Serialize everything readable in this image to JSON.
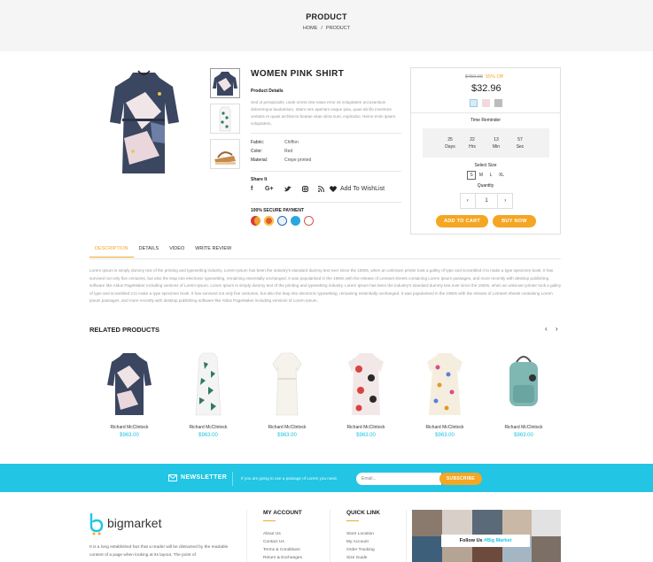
{
  "hero": {
    "title": "PRODUCT",
    "breadcrumb": [
      "HOME",
      "/",
      "PRODUCT"
    ]
  },
  "product": {
    "title": "WOMEN PINK SHIRT",
    "details_label": "Product Details",
    "description": "Sed ut perspiciatis, unde omnis iste natus error sit voluptatem accusantium doloremque laudantium, totam rem aperiam eaque ipsa, quae ab illo inventore veritatis et quasi architecto beatae vitae dicta sunt, explicabo. Nemo enim ipsam voluptatem,",
    "attributes": [
      {
        "label": "Fabric:",
        "value": "Chiffon"
      },
      {
        "label": "Color:",
        "value": "Red"
      },
      {
        "label": "Material:",
        "value": "Crepe printed"
      }
    ],
    "share_label": "Share It",
    "wishlist": "Add To WishList",
    "payment_label": "100% SECURE PAYMENT"
  },
  "buybox": {
    "old_price": "$450.00",
    "discount": "55% Off",
    "price": "$32.96",
    "swatch_colors": [
      "#d6ecf8",
      "#f2d9de",
      "#bcbcbc"
    ],
    "time_reminder": "Time Reminder",
    "timer": [
      {
        "value": "25",
        "unit": "Days"
      },
      {
        "value": "22",
        "unit": "Hrs"
      },
      {
        "value": "13",
        "unit": "Min"
      },
      {
        "value": "57",
        "unit": "Sec"
      }
    ],
    "select_size": "Select Size",
    "sizes": [
      "S",
      "M",
      "L",
      "XL"
    ],
    "quantity_label": "Quantity",
    "quantity_minus": "‹",
    "quantity": "1",
    "quantity_plus": "›",
    "add_to_cart": "ADD TO CART",
    "buy_now": "BUY NOW"
  },
  "tabs": [
    "DESCRIPTION",
    "DETAILS",
    "VIDEO",
    "WRITE REVIEW"
  ],
  "long_description": "Lorem Ipsum is simply dummy text of the printing and typesetting industry. Lorem Ipsum has been the industry's standard dummy text ever since the 1500s, when an unknown printer took a galley of type and scrambled it to make a type specimen book. It has survived not only five centuries, but also the leap into electronic typesetting, remaining essentially unchanged. It was popularised in the 1960s with the release of Letraset sheets containing Lorem Ipsum passages, and more recently with desktop publishing software like Aldus PageMaker including versions of Lorem Ipsum. Lorem Ipsum is simply dummy text of the printing and typesetting industry. Lorem Ipsum has been the industry's standard dummy text ever since the 1500s, when an unknown printer took a galley of type and scrambled it to make a type specimen book. It has survived not only five centuries, but also the leap into electronic typesetting, remaining essentially unchanged. It was popularised in the 1960s with the release of Letraset sheets containing Lorem Ipsum passages, and more recently with desktop publishing software like Aldus PageMaker including versions of Lorem Ipsum.",
  "related": {
    "title": "RELATED PRODUCTS",
    "prev": "‹",
    "next": "›",
    "items": [
      {
        "name": "Richard McClintock",
        "price": "$963.00"
      },
      {
        "name": "Richard McClintock",
        "price": "$963.00"
      },
      {
        "name": "Richard McClintock",
        "price": "$963.00"
      },
      {
        "name": "Richard McClintock",
        "price": "$963.00"
      },
      {
        "name": "Richard McClintock",
        "price": "$963.00"
      },
      {
        "name": "Richard McClintock",
        "price": "$963.00"
      }
    ]
  },
  "newsletter": {
    "label": "NEWSLETTER",
    "text": "If you are going to use a passage of Lorem you need.",
    "placeholder": "Email...",
    "button": "SUBSCRIBE"
  },
  "footer": {
    "logo": "bigmarket",
    "about": "It is a long established fact that a reader will be distracted by the readable content of a page when looking at its layout. The point of",
    "account_title": "MY ACCOUNT",
    "account_links": [
      "About Us",
      "Contact Us",
      "Terms & Conditions",
      "Return & Exchanges"
    ],
    "quick_title": "QUICK LINK",
    "quick_links": [
      "Store Location",
      "My Account",
      "Order Tracking",
      "Size Guide"
    ],
    "follow_prefix": "Follow Us",
    "follow_brand": "#Big Market"
  },
  "colors": {
    "accent": "#f5a623",
    "cyan": "#22c5e3"
  }
}
